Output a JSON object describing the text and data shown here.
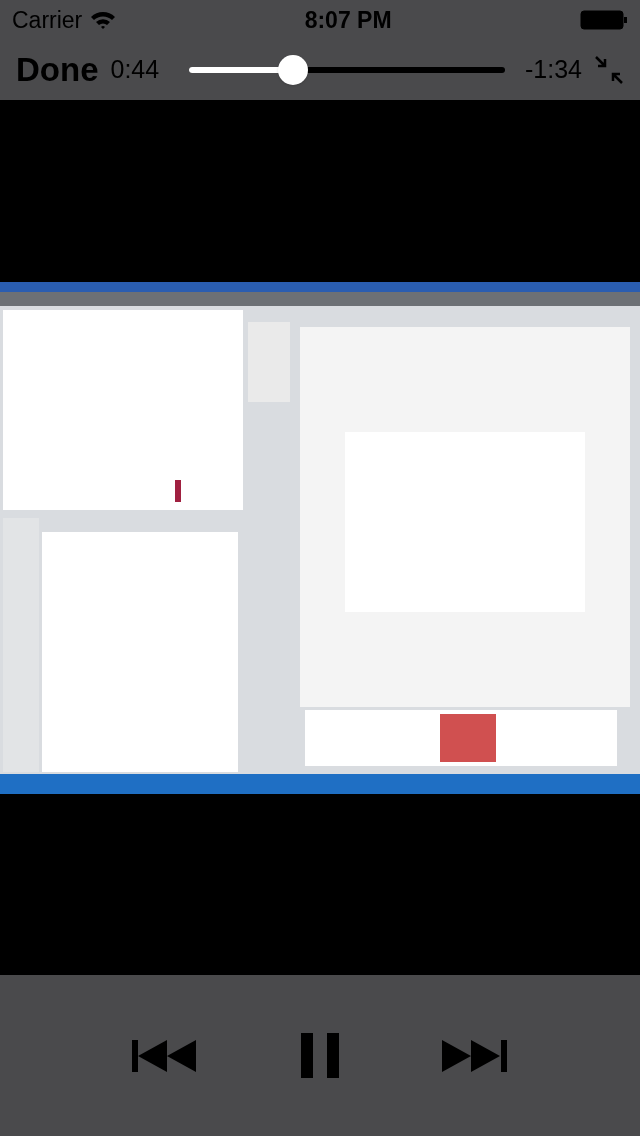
{
  "status_bar": {
    "carrier": "Carrier",
    "time": "8:07 PM"
  },
  "controls": {
    "done": "Done",
    "elapsed": "0:44",
    "remaining": "-1:34",
    "level": 0.33
  },
  "transport": {
    "playing": true
  }
}
